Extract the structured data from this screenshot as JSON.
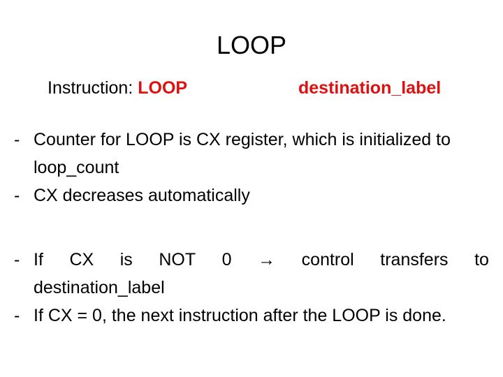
{
  "slide": {
    "title": "LOOP",
    "instruction_label": "Instruction: ",
    "instruction_keyword": "LOOP",
    "instruction_operand": "destination_label",
    "accent_color": "#e01010",
    "bullets_group1": [
      {
        "dash": "-",
        "text": "Counter for LOOP is CX register, which is initialized to loop_count"
      },
      {
        "dash": "-",
        "text": "CX decreases automatically"
      }
    ],
    "bullets_group2": [
      {
        "dash": "-",
        "line1": [
          "If",
          "CX",
          "is",
          "NOT",
          "0",
          "→",
          "control",
          "transfers",
          "to"
        ],
        "line2": "destination_label"
      },
      {
        "dash": "-",
        "text": "If CX = 0, the next instruction after the LOOP is done."
      }
    ]
  }
}
